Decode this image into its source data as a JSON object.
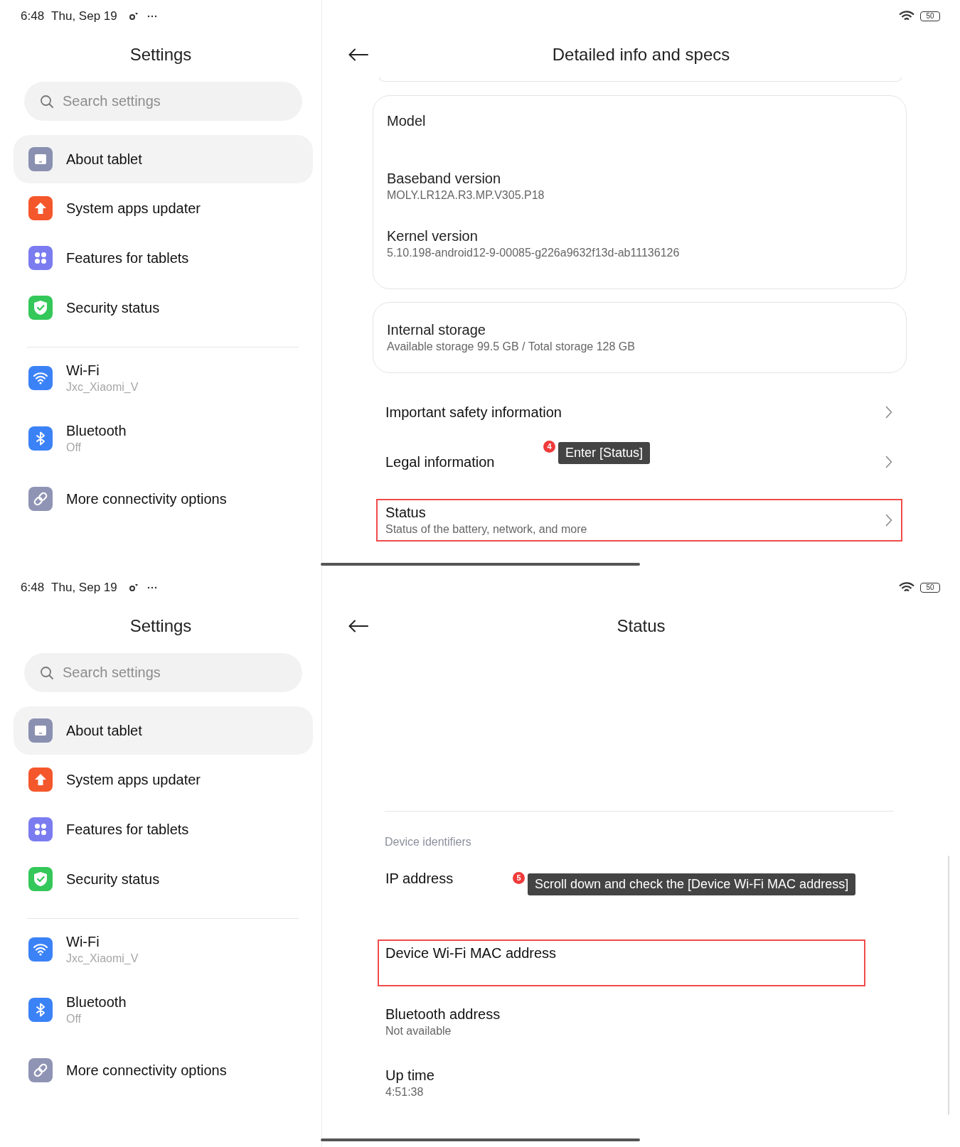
{
  "screens": [
    {
      "status_bar": {
        "time": "6:48",
        "date": "Thu, Sep 19",
        "battery": "50"
      },
      "sidebar": {
        "title": "Settings",
        "search": {
          "placeholder": "Search settings"
        },
        "groups": [
          {
            "items": [
              {
                "label": "About tablet",
                "kind": "tablet",
                "selected": true
              },
              {
                "label": "System apps updater",
                "kind": "update",
                "selected": false
              },
              {
                "label": "Features for tablets",
                "kind": "features",
                "selected": false
              },
              {
                "label": "Security status",
                "kind": "security",
                "selected": false
              }
            ]
          },
          {
            "items": [
              {
                "label": "Wi-Fi",
                "sublabel": "Jxc_Xiaomi_V",
                "kind": "wifi",
                "selected": false
              },
              {
                "label": "Bluetooth",
                "sublabel": "Off",
                "kind": "bluetooth",
                "selected": false
              },
              {
                "label": "More connectivity options",
                "kind": "link",
                "selected": false
              }
            ]
          }
        ]
      },
      "detail": {
        "title": "Detailed info and specs",
        "blocks": [
          {
            "kind": "card_edge"
          },
          {
            "kind": "card",
            "rows": [
              {
                "title": "Model"
              },
              {
                "title": "Baseband version",
                "subtitle": "MOLY.LR12A.R3.MP.V305.P18"
              },
              {
                "title": "Kernel version",
                "subtitle": "5.10.198-android12-9-00085-g226a9632f13d-ab11136126"
              }
            ]
          },
          {
            "kind": "storage_card",
            "title": "Internal storage",
            "subtitle": "Available storage  99.5 GB / Total storage  128 GB"
          },
          {
            "kind": "nav_row",
            "title": "Important safety information",
            "highlighted": false
          },
          {
            "kind": "nav_row",
            "title": "Legal information",
            "highlighted": false,
            "annotation": {
              "number": "4",
              "text": "Enter [Status]"
            }
          },
          {
            "kind": "nav_row",
            "title": "Status",
            "subtitle": "Status of the battery, network, and more",
            "highlighted": true
          }
        ]
      }
    },
    {
      "status_bar": {
        "time": "6:48",
        "date": "Thu, Sep 19",
        "battery": "50"
      },
      "sidebar": {
        "title": "Settings",
        "search": {
          "placeholder": "Search settings"
        },
        "groups": [
          {
            "items": [
              {
                "label": "About tablet",
                "kind": "tablet",
                "selected": true
              },
              {
                "label": "System apps updater",
                "kind": "update",
                "selected": false
              },
              {
                "label": "Features for tablets",
                "kind": "features",
                "selected": false
              },
              {
                "label": "Security status",
                "kind": "security",
                "selected": false
              }
            ]
          },
          {
            "items": [
              {
                "label": "Wi-Fi",
                "sublabel": "Jxc_Xiaomi_V",
                "kind": "wifi",
                "selected": false
              },
              {
                "label": "Bluetooth",
                "sublabel": "Off",
                "kind": "bluetooth",
                "selected": false
              },
              {
                "label": "More connectivity options",
                "kind": "link",
                "selected": false
              }
            ]
          }
        ]
      },
      "detail": {
        "title": "Status",
        "blocks": [
          {
            "kind": "divider"
          },
          {
            "kind": "section_header",
            "text": "Device identifiers"
          },
          {
            "kind": "info_row",
            "title": "IP address",
            "highlighted": false,
            "annotation": {
              "number": "5",
              "text": "Scroll down and check the [Device Wi-Fi MAC address]"
            }
          },
          {
            "kind": "info_row",
            "title": "Device Wi-Fi MAC address",
            "highlighted": true
          },
          {
            "kind": "info_row",
            "title": "Bluetooth address",
            "subtitle": "Not available",
            "highlighted": false
          },
          {
            "kind": "info_row",
            "title": "Up time",
            "subtitle": "4:51:38",
            "highlighted": false
          },
          {
            "kind": "scrollbar"
          }
        ]
      }
    }
  ]
}
